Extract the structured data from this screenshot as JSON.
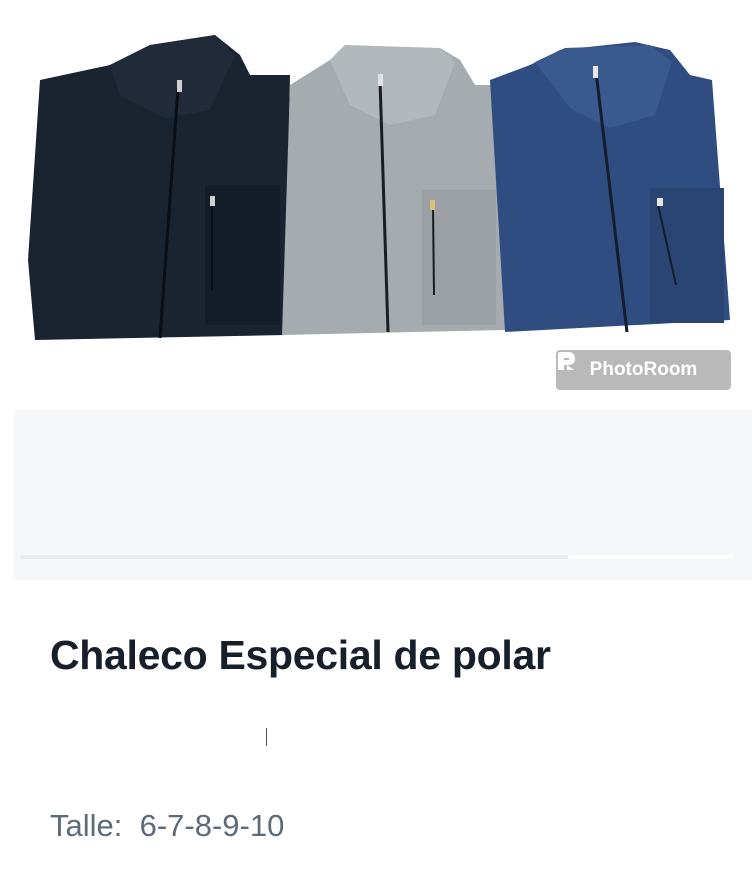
{
  "product": {
    "image_alt": "three fleece vests: black, grey, navy",
    "garment_colors": [
      "#1a2330",
      "#9aa0a6",
      "#2f4d80"
    ],
    "watermark_text": "PhotoRoom",
    "title": "Chaleco Especial de polar",
    "size_label": "Talle:",
    "size_values": "6-7-8-9-10"
  },
  "gallery": {
    "scroll_position": 0.8
  }
}
